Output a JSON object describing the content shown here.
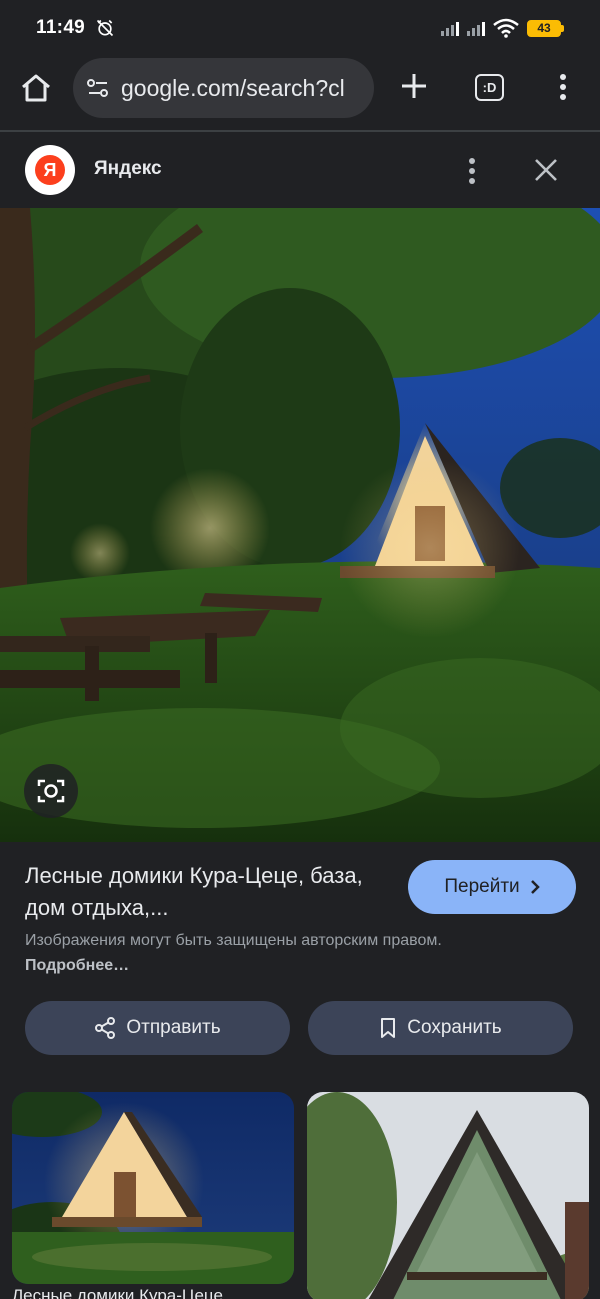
{
  "status_bar": {
    "time": "11:49",
    "battery": "43"
  },
  "toolbar": {
    "url": "google.com/search?cl",
    "tab_count": ":D"
  },
  "source": {
    "name": "Яндекс",
    "logo_letter": "Я"
  },
  "result": {
    "title": "Лесные домики Кура-Цеце, база, дом отдыха,...",
    "visit_label": "Перейти",
    "copyright_text": "Изображения могут быть защищены авторским правом.",
    "copyright_link": "Подробнее…"
  },
  "actions": {
    "share_label": "Отправить",
    "save_label": "Сохранить"
  },
  "related": {
    "caption_1": "Лесные домики Кура-Цеце..."
  },
  "colors": {
    "accent": "#8ab4f8",
    "background": "#202124",
    "action_bg": "#3c4458"
  }
}
